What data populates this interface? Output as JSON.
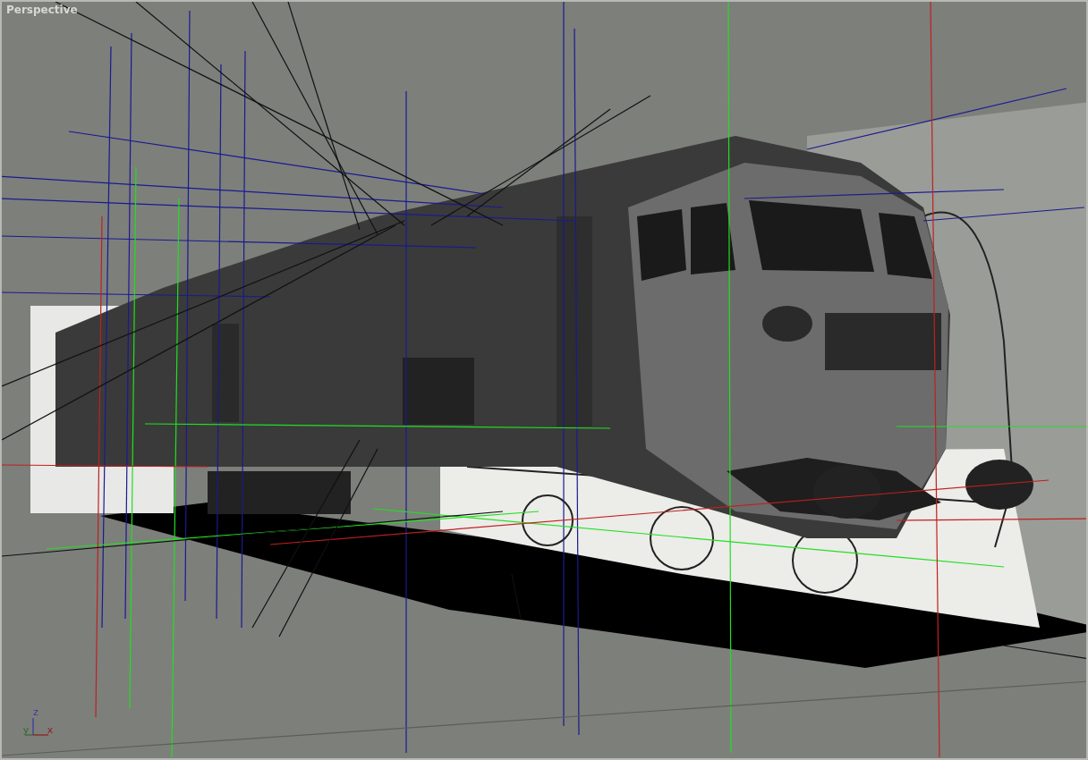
{
  "viewport": {
    "label": "Perspective",
    "axes": [
      {
        "name": "z",
        "color": "#3a3a9a"
      },
      {
        "name": "y",
        "color": "#2f6a2f"
      },
      {
        "name": "x",
        "color": "#8a1e1e"
      }
    ]
  }
}
